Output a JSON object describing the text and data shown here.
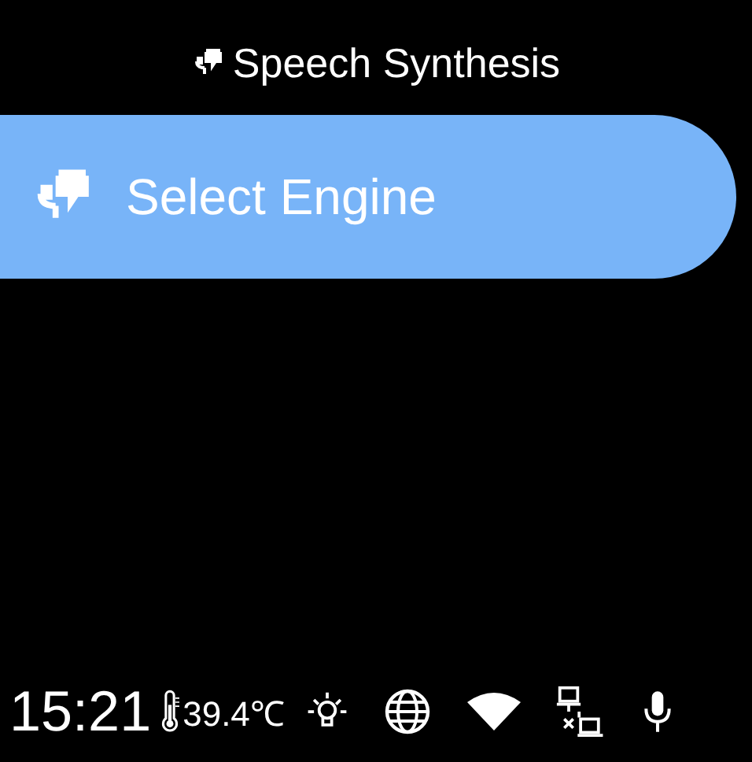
{
  "header": {
    "title": "Speech Synthesis"
  },
  "menu": [
    {
      "label": "Select Engine",
      "selected": true
    }
  ],
  "status_bar": {
    "time": "15:21",
    "temperature": "39.4℃"
  }
}
